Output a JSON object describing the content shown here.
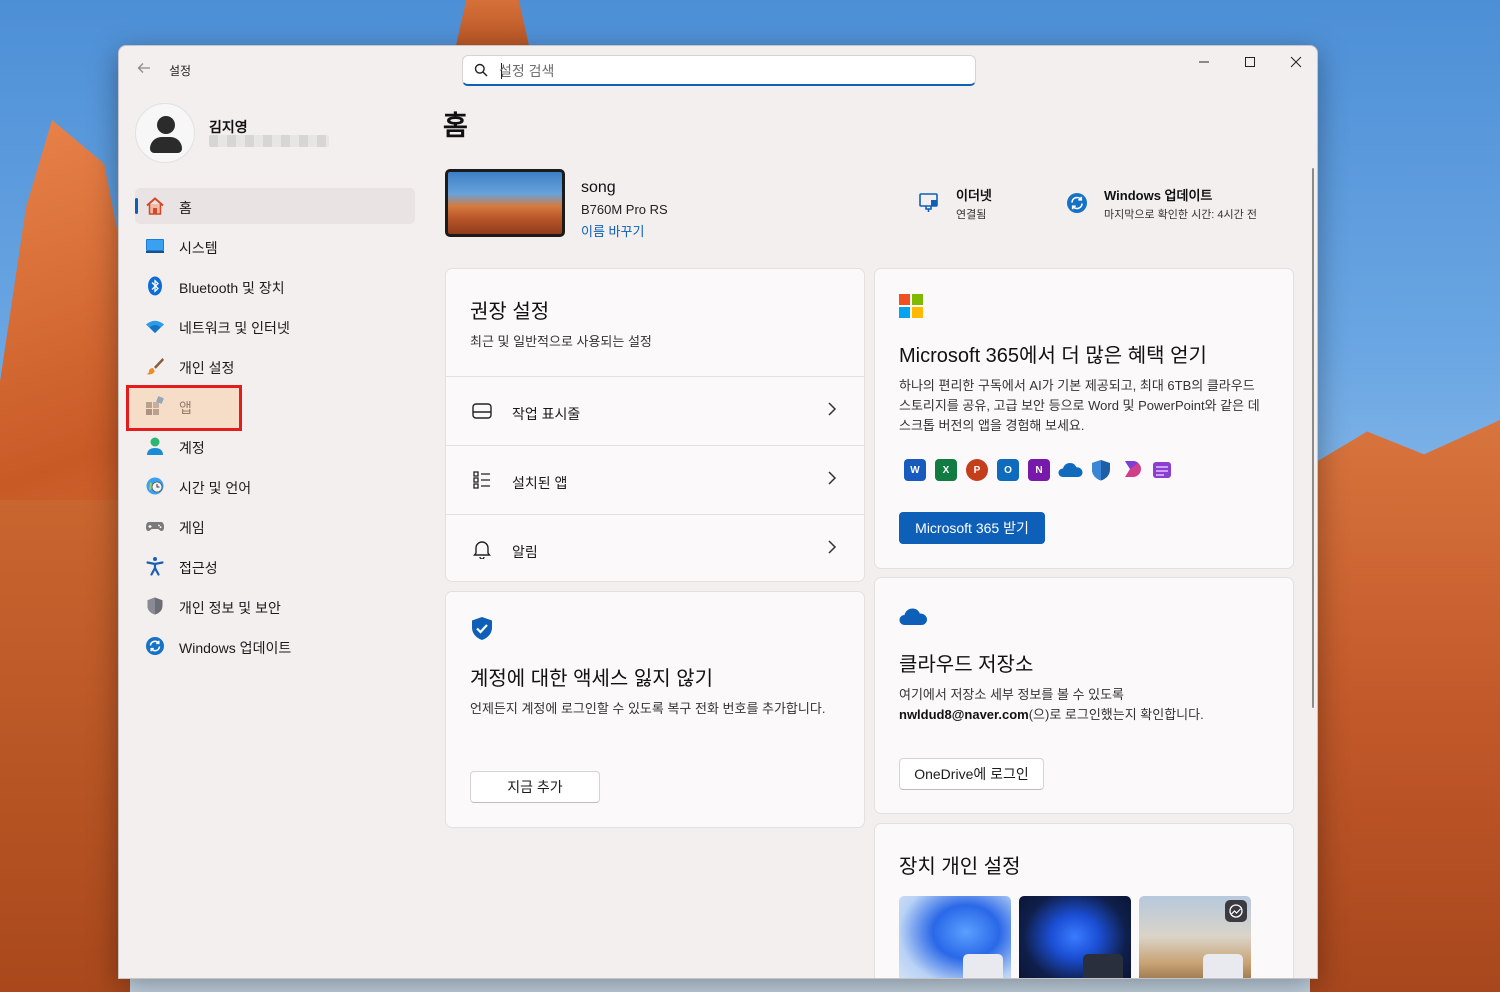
{
  "window": {
    "title": "설정",
    "search_placeholder": "설정 검색"
  },
  "profile": {
    "name": "김지영"
  },
  "sidebar": {
    "items": [
      {
        "label": "홈",
        "icon": "home-icon",
        "active": true
      },
      {
        "label": "시스템",
        "icon": "system-icon"
      },
      {
        "label": "Bluetooth 및 장치",
        "icon": "bluetooth-icon"
      },
      {
        "label": "네트워크 및 인터넷",
        "icon": "network-icon"
      },
      {
        "label": "개인 설정",
        "icon": "brush-icon"
      },
      {
        "label": "앱",
        "icon": "apps-icon",
        "highlighted": true
      },
      {
        "label": "계정",
        "icon": "account-icon"
      },
      {
        "label": "시간 및 언어",
        "icon": "time-language-icon"
      },
      {
        "label": "게임",
        "icon": "gamepad-icon"
      },
      {
        "label": "접근성",
        "icon": "accessibility-icon"
      },
      {
        "label": "개인 정보 및 보안",
        "icon": "shield-icon"
      },
      {
        "label": "Windows 업데이트",
        "icon": "update-icon"
      }
    ]
  },
  "main": {
    "title": "홈",
    "device": {
      "name": "song",
      "model": "B760M Pro RS",
      "rename_link": "이름 바꾸기"
    },
    "status": {
      "ethernet_title": "이더넷",
      "ethernet_sub": "연결됨",
      "update_title": "Windows 업데이트",
      "update_sub": "마지막으로 확인한 시간: 4시간 전"
    },
    "recommended": {
      "title": "권장 설정",
      "subtitle": "최근 및 일반적으로 사용되는 설정",
      "items": [
        {
          "label": "작업 표시줄",
          "icon": "taskbar-icon"
        },
        {
          "label": "설치된 앱",
          "icon": "installed-apps-icon"
        },
        {
          "label": "알림",
          "icon": "bell-icon"
        }
      ]
    },
    "account_card": {
      "title": "계정에 대한 액세스 잃지 않기",
      "body": "언제든지 계정에 로그인할 수 있도록 복구 전화 번호를 추가합니다.",
      "button": "지금 추가"
    },
    "m365_card": {
      "title": "Microsoft 365에서 더 많은 혜택 얻기",
      "body": "하나의 편리한 구독에서 AI가 기본 제공되고, 최대 6TB의 클라우드 스토리지를 공유, 고급 보안 등으로 Word 및 PowerPoint와 같은 데스크톱 버전의 앱을 경험해 보세요.",
      "button": "Microsoft 365 받기",
      "apps": [
        {
          "name": "word-icon",
          "letter": "W",
          "color": "#185abd"
        },
        {
          "name": "excel-icon",
          "letter": "X",
          "color": "#107c41"
        },
        {
          "name": "powerpoint-icon",
          "letter": "P",
          "color": "#c43e1c"
        },
        {
          "name": "outlook-icon",
          "letter": "O",
          "color": "#0f6cbd"
        },
        {
          "name": "onenote-icon",
          "letter": "N",
          "color": "#7719aa"
        },
        {
          "name": "onedrive-icon",
          "letter": "",
          "color": "#0f6cbd"
        },
        {
          "name": "defender-icon",
          "letter": "",
          "color": "#1f5fa8"
        },
        {
          "name": "clipchamp-icon",
          "letter": "",
          "color": "#d13f8a"
        },
        {
          "name": "designer-icon",
          "letter": "",
          "color": "#8a3fd1"
        }
      ]
    },
    "cloud_card": {
      "title": "클라우드 저장소",
      "body_line1": "여기에서 저장소 세부 정보를 볼 수 있도록",
      "email": "nwldud8@naver.com",
      "body_line2_suffix": "(으)로 로그인했는지 확인합니다.",
      "button": "OneDrive에 로그인"
    },
    "customize_card": {
      "title": "장치 개인 설정"
    }
  },
  "colors": {
    "accent": "#0e5fb8",
    "highlight_border": "#e11d1d"
  }
}
